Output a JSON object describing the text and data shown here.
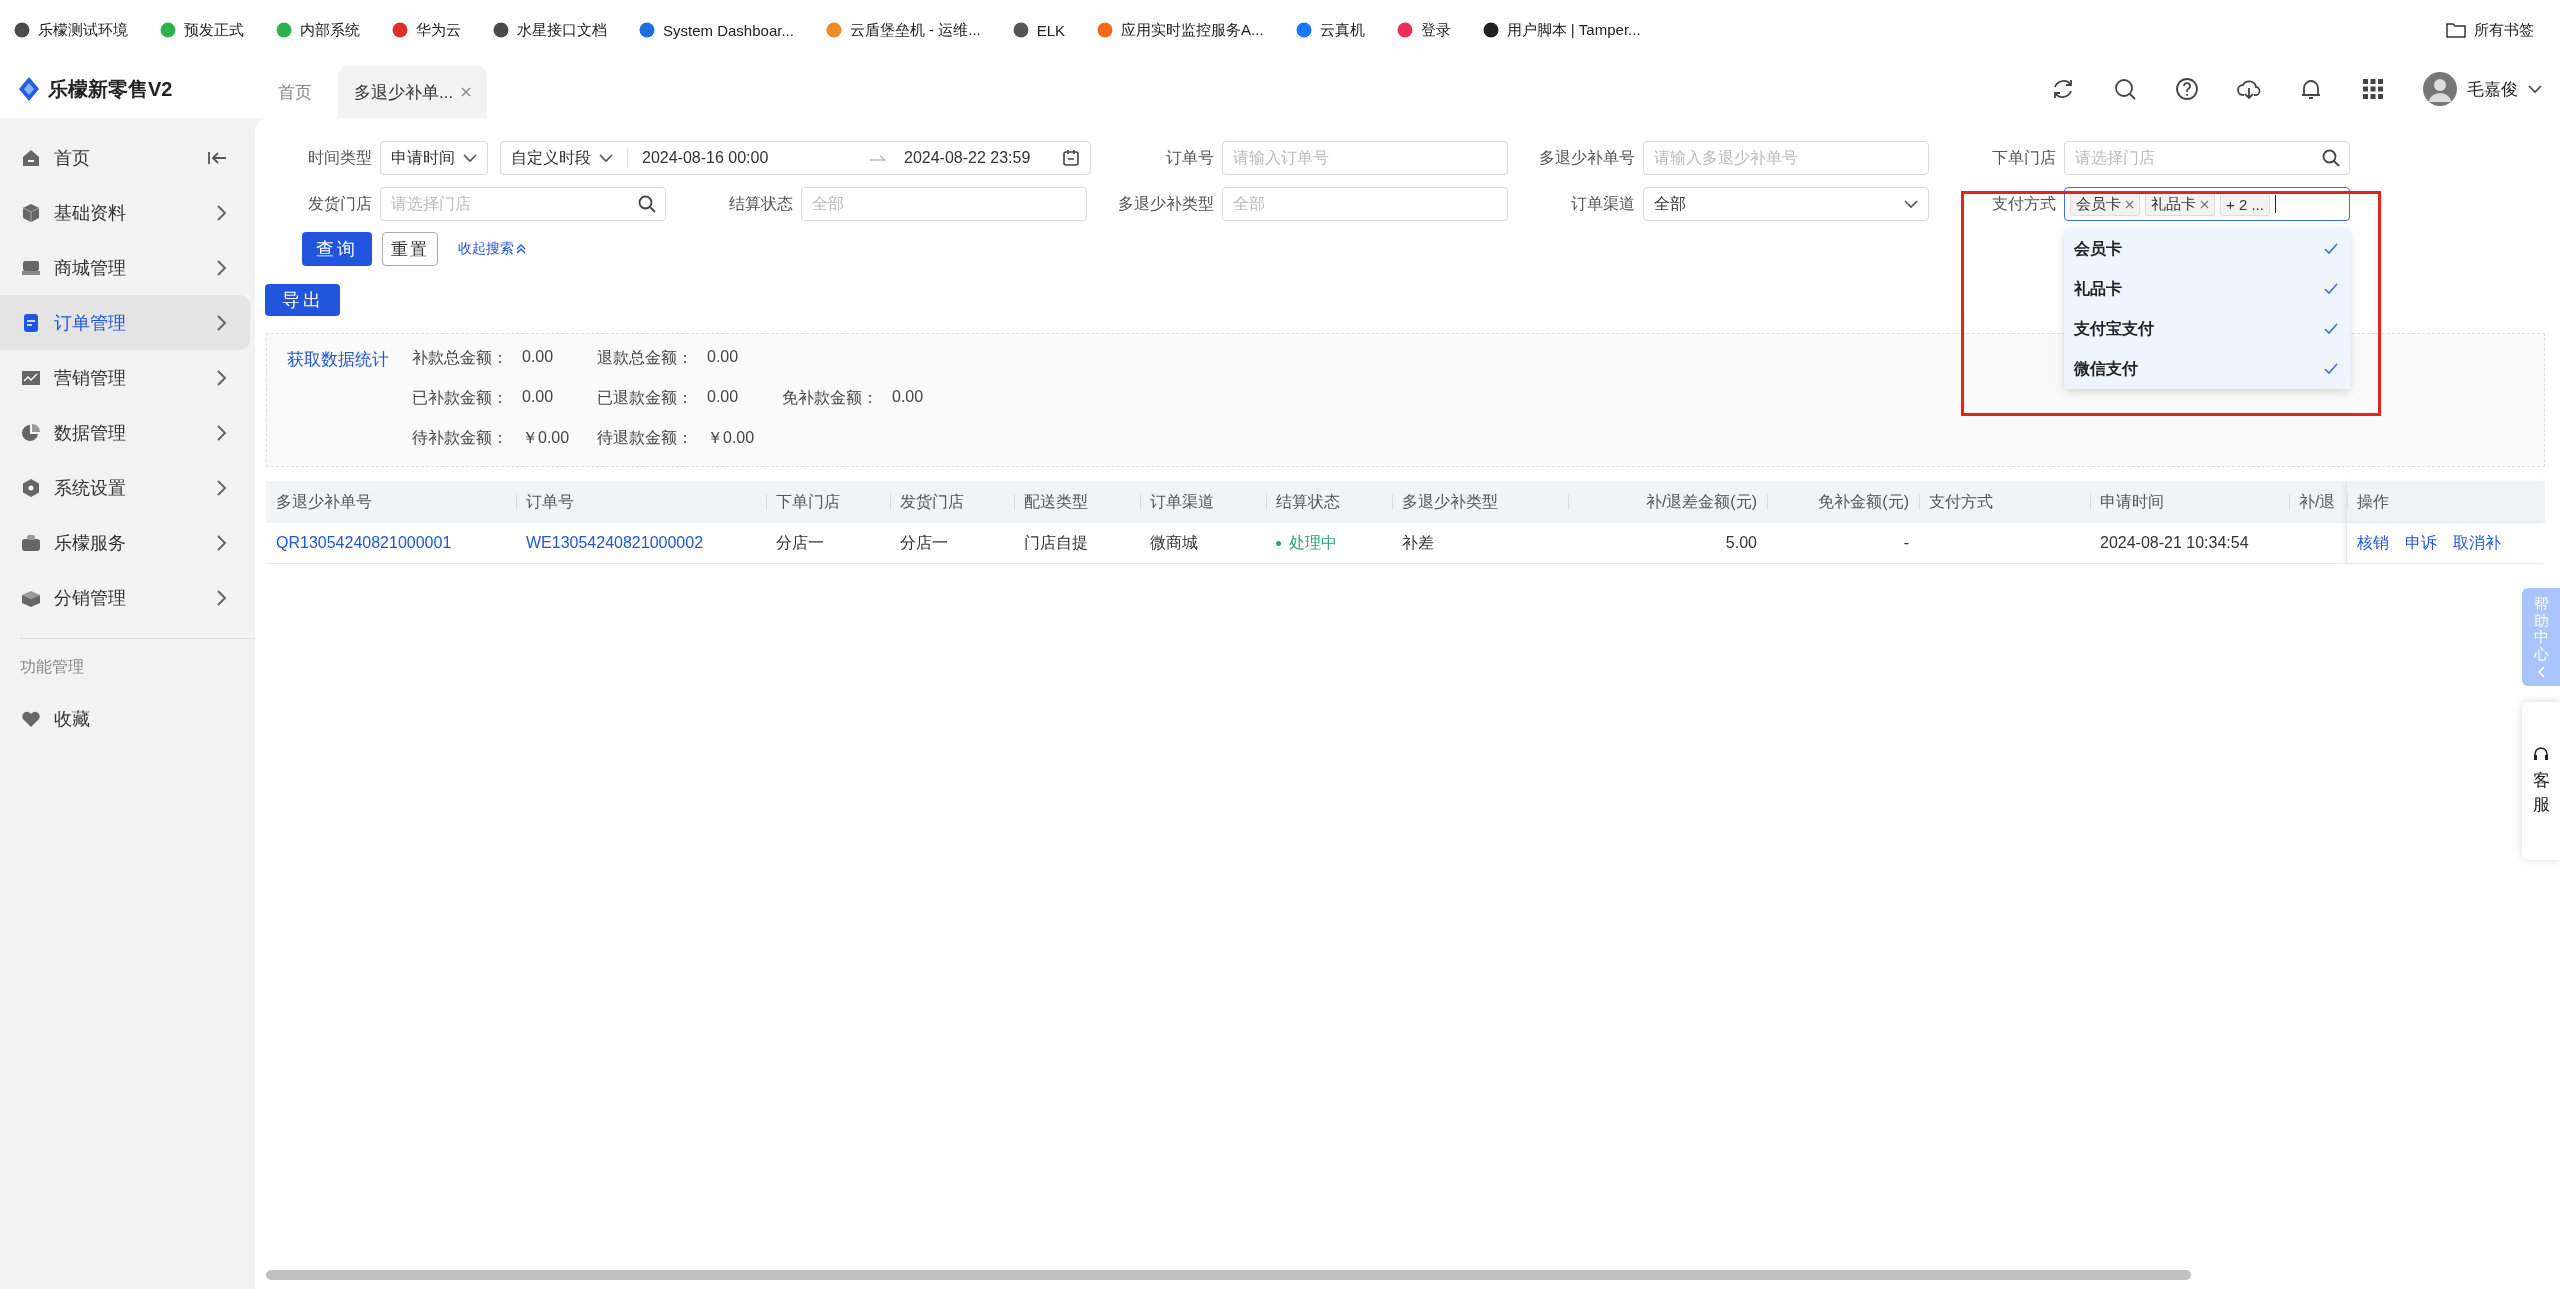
{
  "bookmarks": [
    {
      "label": "乐檬测试环境",
      "color": "#4a4a4a"
    },
    {
      "label": "预发正式",
      "color": "#2bb24c"
    },
    {
      "label": "内部系统",
      "color": "#2bb24c"
    },
    {
      "label": "华为云",
      "color": "#e0302a"
    },
    {
      "label": "水星接口文档",
      "color": "#4a4a4a"
    },
    {
      "label": "System Dashboar...",
      "color": "#1e6fe0"
    },
    {
      "label": "云盾堡垒机 - 运维...",
      "color": "#f08a24"
    },
    {
      "label": "ELK",
      "color": "#555555"
    },
    {
      "label": "应用实时监控服务A...",
      "color": "#f06a1a"
    },
    {
      "label": "云真机",
      "color": "#1677ff"
    },
    {
      "label": "登录",
      "color": "#e8305a"
    },
    {
      "label": "用户脚本 | Tamper...",
      "color": "#222222"
    }
  ],
  "all_bookmarks": "所有书签",
  "app": {
    "name": "乐檬新零售V2"
  },
  "page_tabs": [
    {
      "label": "首页",
      "selected": false,
      "closable": false
    },
    {
      "label": "多退少补单...",
      "selected": true,
      "closable": true
    }
  ],
  "user": {
    "name": "毛嘉俊"
  },
  "sidebar": {
    "items": [
      {
        "label": "首页",
        "kind": "home",
        "selected": false
      },
      {
        "label": "基础资料",
        "kind": "submenu",
        "selected": false
      },
      {
        "label": "商城管理",
        "kind": "submenu",
        "selected": false
      },
      {
        "label": "订单管理",
        "kind": "submenu",
        "selected": true
      },
      {
        "label": "营销管理",
        "kind": "submenu",
        "selected": false
      },
      {
        "label": "数据管理",
        "kind": "submenu",
        "selected": false
      },
      {
        "label": "系统设置",
        "kind": "submenu",
        "selected": false
      },
      {
        "label": "乐檬服务",
        "kind": "submenu",
        "selected": false
      },
      {
        "label": "分销管理",
        "kind": "submenu",
        "selected": false
      }
    ],
    "section": "功能管理",
    "favorites": [
      {
        "label": "收藏"
      }
    ]
  },
  "filters": [
    {
      "label": "时间类型",
      "kind": "time_range",
      "type_value": "申请时间",
      "range_value": "自定义时段",
      "start": "2024-08-16 00:00",
      "end": "2024-08-22 23:59"
    },
    {
      "label": "订单号",
      "kind": "input",
      "placeholder": "请输入订单号"
    },
    {
      "label": "多退少补单号",
      "kind": "input",
      "placeholder": "请输入多退少补单号"
    },
    {
      "label": "下单门店",
      "kind": "search",
      "placeholder": "请选择门店"
    },
    {
      "label": "发货门店",
      "kind": "search",
      "placeholder": "请选择门店"
    },
    {
      "label": "结算状态",
      "kind": "input",
      "placeholder": "全部"
    },
    {
      "label": "多退少补类型",
      "kind": "input",
      "placeholder": "全部"
    },
    {
      "label": "订单渠道",
      "kind": "select",
      "value": "全部"
    },
    {
      "label": "支付方式",
      "kind": "tags",
      "tags": [
        "会员卡",
        "礼品卡"
      ],
      "more": "+ 2 ...",
      "focused": true,
      "options": [
        {
          "label": "会员卡",
          "checked": true
        },
        {
          "label": "礼品卡",
          "checked": true
        },
        {
          "label": "支付宝支付",
          "checked": true
        },
        {
          "label": "微信支付",
          "checked": true
        }
      ]
    }
  ],
  "actions": {
    "query": "查询",
    "reset": "重置",
    "collapse": "收起搜索",
    "export": "导出"
  },
  "stats": {
    "link": "获取数据统计",
    "rows": [
      [
        {
          "label": "补款总金额：",
          "value": "0.00"
        },
        {
          "label": "退款总金额：",
          "value": "0.00"
        }
      ],
      [
        {
          "label": "已补款金额：",
          "value": "0.00"
        },
        {
          "label": "已退款金额：",
          "value": "0.00"
        },
        {
          "label": "免补款金额：",
          "value": "0.00"
        }
      ],
      [
        {
          "label": "待补款金额：",
          "value": "￥0.00"
        },
        {
          "label": "待退款金额：",
          "value": "￥0.00"
        }
      ]
    ]
  },
  "table": {
    "columns": [
      {
        "label": "多退少补单号"
      },
      {
        "label": "订单号"
      },
      {
        "label": "下单门店"
      },
      {
        "label": "发货门店"
      },
      {
        "label": "配送类型"
      },
      {
        "label": "订单渠道"
      },
      {
        "label": "结算状态"
      },
      {
        "label": "多退少补类型"
      },
      {
        "label": "补/退差金额(元)"
      },
      {
        "label": "免补金额(元)"
      },
      {
        "label": "支付方式"
      },
      {
        "label": "申请时间"
      },
      {
        "label": "补/退"
      },
      {
        "label": "操作"
      }
    ],
    "rows": [
      {
        "cells": [
          {
            "text": "QR13054240821000001",
            "kind": "link"
          },
          {
            "text": "WE13054240821000002",
            "kind": "link"
          },
          {
            "text": "分店一",
            "kind": "text"
          },
          {
            "text": "分店一",
            "kind": "text"
          },
          {
            "text": "门店自提",
            "kind": "text"
          },
          {
            "text": "微商城",
            "kind": "text"
          },
          {
            "text": "处理中",
            "kind": "status",
            "color": "#2ba471"
          },
          {
            "text": "补差",
            "kind": "text"
          },
          {
            "text": "5.00",
            "kind": "text"
          },
          {
            "text": "-",
            "kind": "text"
          },
          {
            "kind": "blank"
          },
          {
            "text": "2024-08-21 10:34:54",
            "kind": "text"
          },
          {
            "kind": "blank"
          }
        ],
        "actions": [
          "核销",
          "申诉",
          "取消补"
        ]
      }
    ]
  },
  "side_tabs": {
    "help": "帮助中心",
    "service": "客服"
  }
}
